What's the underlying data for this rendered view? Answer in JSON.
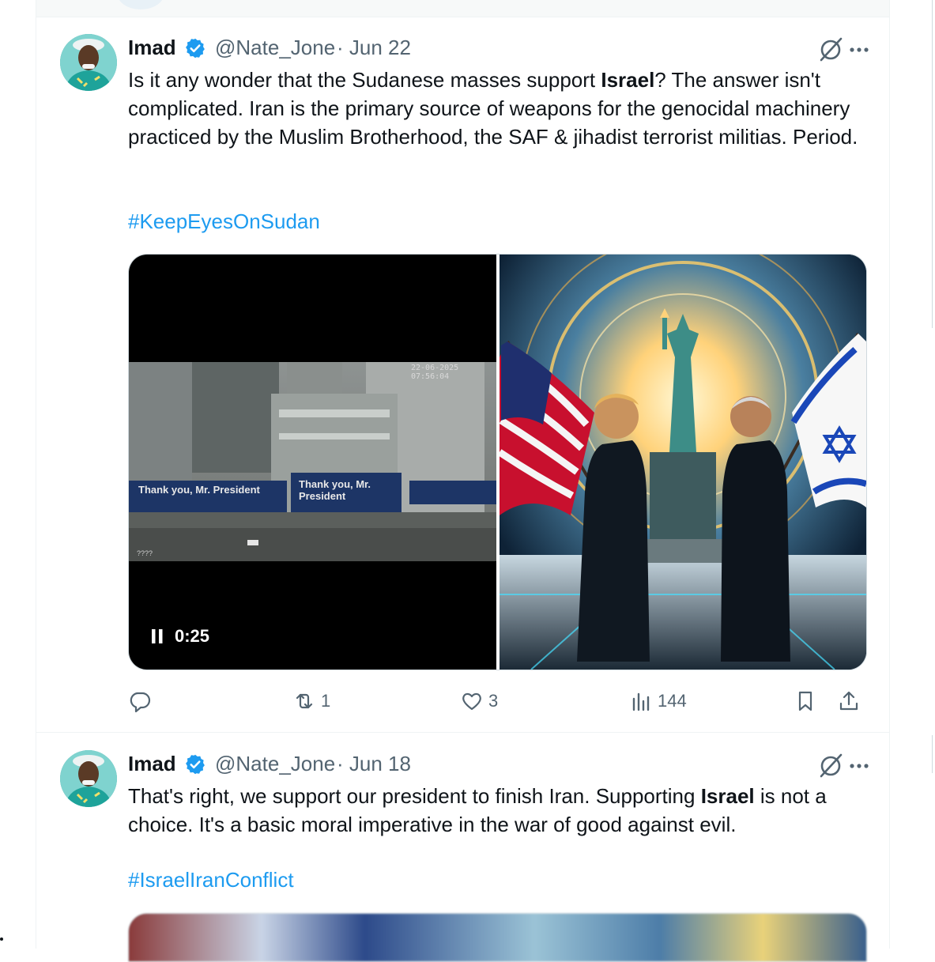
{
  "tweets": [
    {
      "name": "Imad",
      "handle": "@Nate_Jone",
      "date": "· Jun 22",
      "text_parts": [
        "Is it any wonder that the Sudanese masses support ",
        "Israel",
        "? The answer isn't complicated. Iran is the primary source of weapons for the genocidal machinery practiced by the Muslim Brotherhood, the SAF & jihadist terrorist militias. Period."
      ],
      "hashtag": "#KeepEyesOnSudan",
      "video": {
        "duration": "0:25",
        "timestamp_overlay": "22-06-2025 07:56:04",
        "billboard_1": "Thank you, Mr. President",
        "billboard_2": "Thank you, Mr. President",
        "caption": "????"
      },
      "actions": {
        "replies": "",
        "reposts": "1",
        "likes": "3",
        "views": "144"
      }
    },
    {
      "name": "Imad",
      "handle": "@Nate_Jone",
      "date": "· Jun 18",
      "text_parts": [
        "That's right, we support our president to finish Iran. Supporting ",
        "Israel",
        " is not a choice. It's a basic moral imperative in the war of good against evil."
      ],
      "hashtag": "#IsraelIranConflict"
    }
  ],
  "colors": {
    "link": "#1d9bf0",
    "secondary_text": "#536471",
    "verified_badge": "#1d9bf0",
    "border": "#eff3f4"
  },
  "icons": {
    "verified": "verified-badge-icon",
    "grok": "grok-icon",
    "more": "more-icon",
    "reply": "reply-icon",
    "repost": "repost-icon",
    "like": "like-icon",
    "views": "views-icon",
    "bookmark": "bookmark-icon",
    "share": "share-icon",
    "pause": "pause-icon"
  }
}
